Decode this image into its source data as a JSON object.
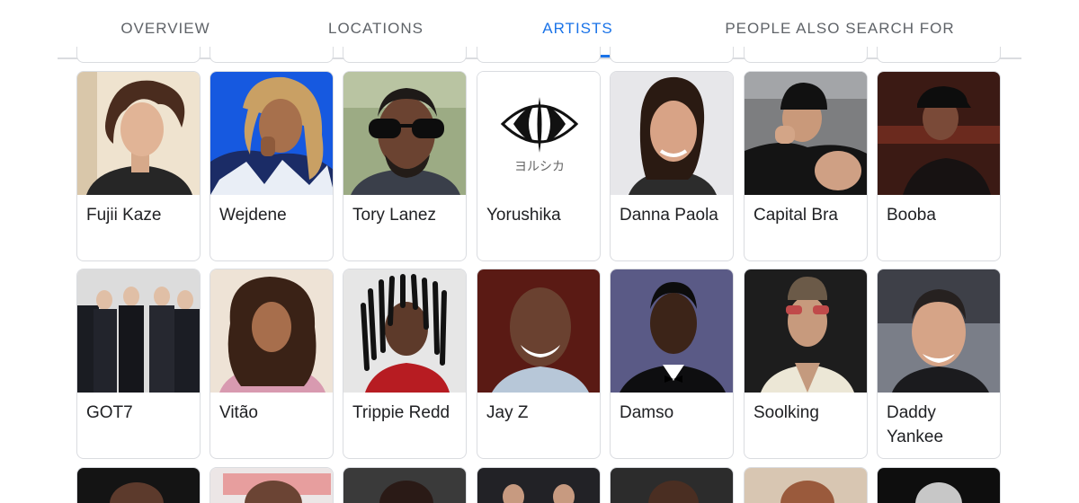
{
  "tabs": [
    {
      "label": "OVERVIEW",
      "active": false
    },
    {
      "label": "LOCATIONS",
      "active": false
    },
    {
      "label": "ARTISTS",
      "active": true
    },
    {
      "label": "PEOPLE ALSO SEARCH FOR",
      "active": false
    }
  ],
  "accent_color": "#1a73e8",
  "artists_row1": [
    {
      "name": "Fujii Kaze"
    },
    {
      "name": "Wejdene"
    },
    {
      "name": "Tory Lanez"
    },
    {
      "name": "Yorushika",
      "logo_text": "ヨルシカ"
    },
    {
      "name": "Danna Paola"
    },
    {
      "name": "Capital Bra"
    },
    {
      "name": "Booba"
    }
  ],
  "artists_row2": [
    {
      "name": "GOT7"
    },
    {
      "name": "Vitão"
    },
    {
      "name": "Trippie Redd"
    },
    {
      "name": "Jay Z"
    },
    {
      "name": "Damso"
    },
    {
      "name": "Soolking"
    },
    {
      "name": "Daddy Yankee"
    }
  ]
}
